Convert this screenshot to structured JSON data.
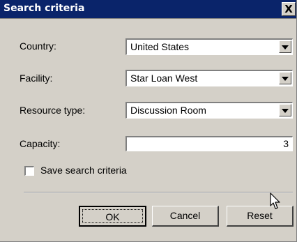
{
  "dialog": {
    "title": "Search criteria",
    "close_label": "X"
  },
  "fields": {
    "country": {
      "label": "Country:",
      "value": "United States"
    },
    "facility": {
      "label": "Facility:",
      "value": "Star Loan West"
    },
    "resource_type": {
      "label": "Resource type:",
      "value": "Discussion Room"
    },
    "capacity": {
      "label": "Capacity:",
      "value": "3"
    }
  },
  "save_criteria": {
    "label": "Save search criteria",
    "checked": false
  },
  "buttons": {
    "ok": "OK",
    "cancel": "Cancel",
    "reset": "Reset"
  },
  "icons": {
    "dropdown": "chevron-down-icon",
    "cursor": "mouse-pointer-icon"
  }
}
